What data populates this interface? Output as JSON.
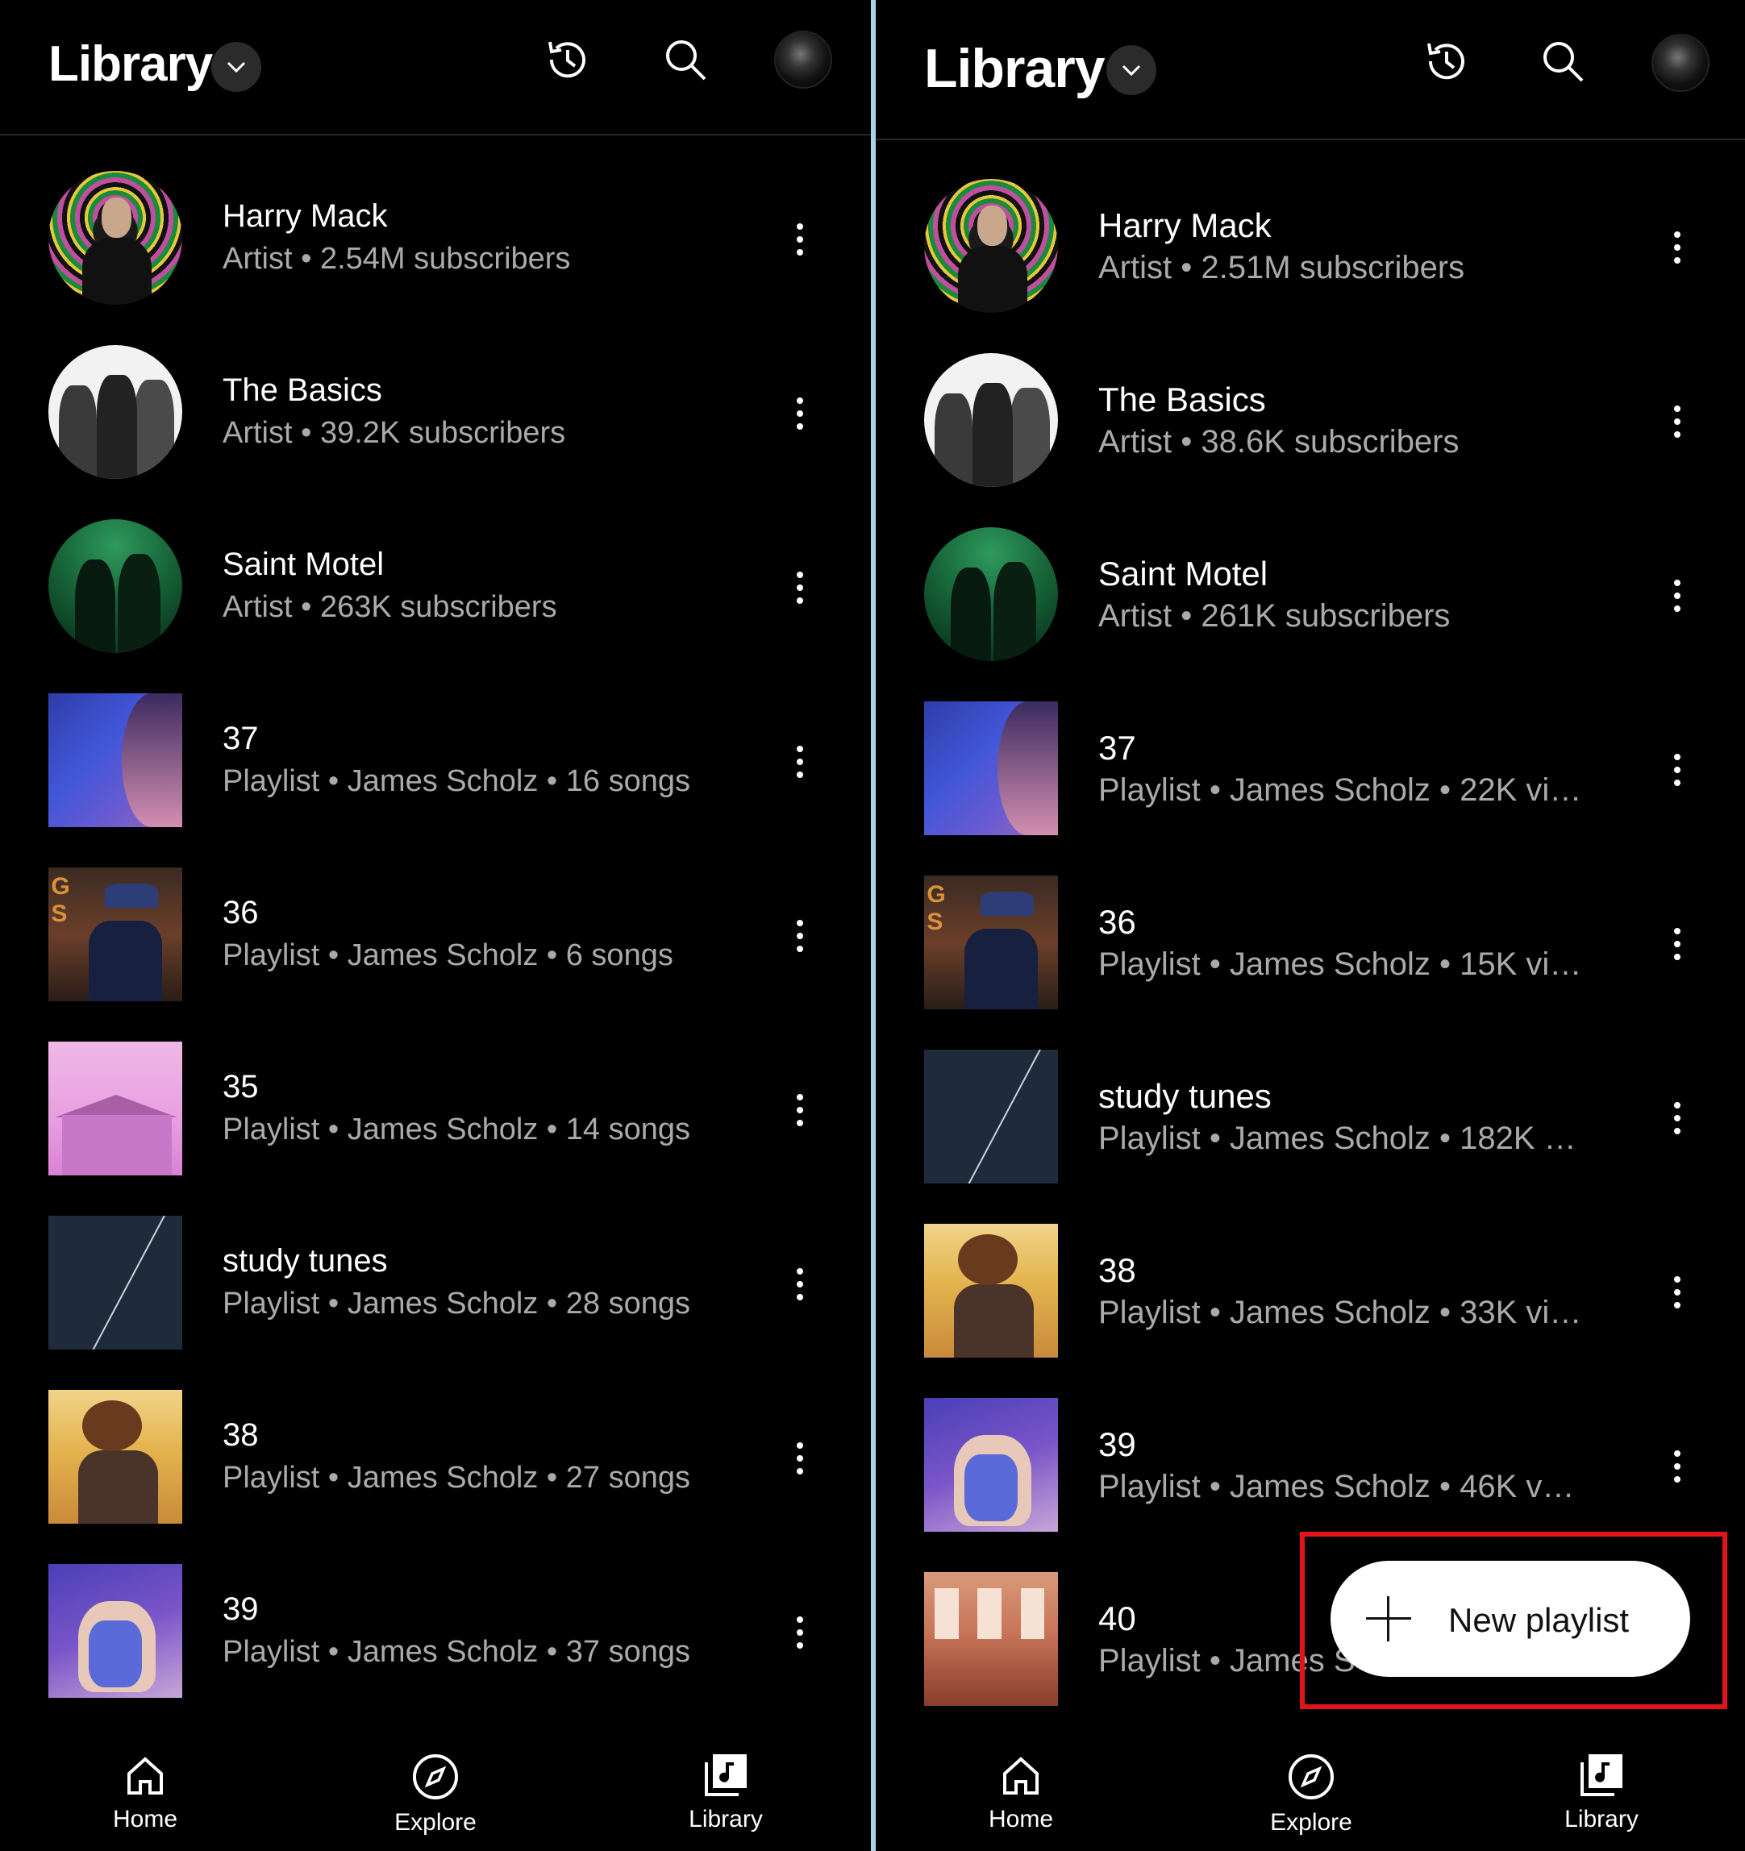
{
  "left": {
    "header": {
      "title": "Library"
    },
    "items": [
      {
        "title": "Harry Mack",
        "subtitle": "Artist • 2.54M subscribers",
        "thumb": "harry"
      },
      {
        "title": "The Basics",
        "subtitle": "Artist • 39.2K subscribers",
        "thumb": "basics"
      },
      {
        "title": "Saint Motel",
        "subtitle": "Artist • 263K subscribers",
        "thumb": "saint"
      },
      {
        "title": "37",
        "subtitle": "Playlist • James Scholz • 16 songs",
        "thumb": "37"
      },
      {
        "title": "36",
        "subtitle": "Playlist • James Scholz • 6 songs",
        "thumb": "36"
      },
      {
        "title": "35",
        "subtitle": "Playlist • James Scholz • 14 songs",
        "thumb": "35"
      },
      {
        "title": "study tunes",
        "subtitle": "Playlist • James Scholz • 28 songs",
        "thumb": "study"
      },
      {
        "title": "38",
        "subtitle": "Playlist • James Scholz • 27 songs",
        "thumb": "38"
      },
      {
        "title": "39",
        "subtitle": "Playlist • James Scholz • 37 songs",
        "thumb": "39"
      }
    ],
    "nav": {
      "home": "Home",
      "explore": "Explore",
      "library": "Library"
    }
  },
  "right": {
    "header": {
      "title": "Library"
    },
    "items": [
      {
        "title": "Harry Mack",
        "subtitle": "Artist • 2.51M subscribers",
        "thumb": "harry"
      },
      {
        "title": "The Basics",
        "subtitle": "Artist • 38.6K subscribers",
        "thumb": "basics"
      },
      {
        "title": "Saint Motel",
        "subtitle": "Artist • 261K subscribers",
        "thumb": "saint"
      },
      {
        "title": "37",
        "subtitle": "Playlist • James Scholz • 22K vi…",
        "thumb": "37"
      },
      {
        "title": "36",
        "subtitle": "Playlist • James Scholz • 15K vi…",
        "thumb": "36"
      },
      {
        "title": "study tunes",
        "subtitle": "Playlist • James Scholz • 182K …",
        "thumb": "study"
      },
      {
        "title": "38",
        "subtitle": "Playlist • James Scholz • 33K vi…",
        "thumb": "38"
      },
      {
        "title": "39",
        "subtitle": "Playlist • James Scholz • 46K v…",
        "thumb": "39"
      },
      {
        "title": "40",
        "subtitle": "Playlist • James S",
        "thumb": "40"
      }
    ],
    "fab": {
      "label": "New playlist"
    },
    "nav": {
      "home": "Home",
      "explore": "Explore",
      "library": "Library"
    }
  },
  "colors": {
    "background": "#000000",
    "subtitle": "#aaaaaa",
    "highlight": "#e2141a",
    "divider": "#a9d3e6"
  },
  "icons": [
    "chevron-down-icon",
    "history-icon",
    "search-icon",
    "more-vert-icon",
    "home-icon",
    "explore-icon",
    "library-music-icon",
    "plus-icon"
  ]
}
